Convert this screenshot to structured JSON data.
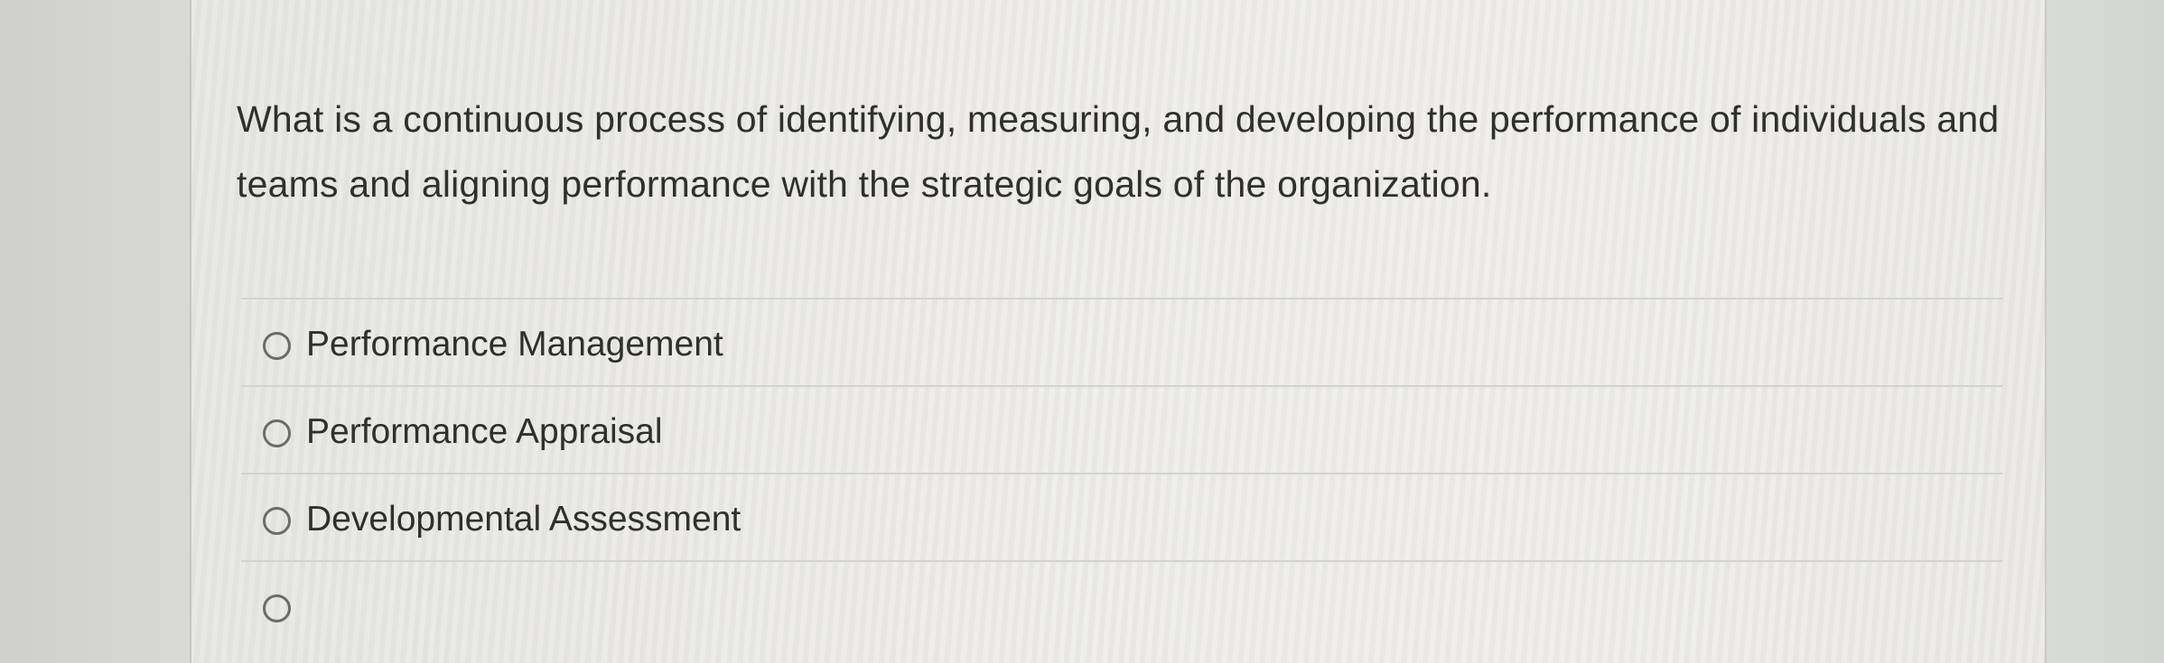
{
  "question": {
    "text": "What is a continuous process of identifying, measuring, and developing the performance of individuals and teams and aligning performance with the strategic goals of the organization."
  },
  "options": [
    {
      "label": "Performance Management",
      "selected": false
    },
    {
      "label": "Performance Appraisal",
      "selected": false
    },
    {
      "label": "Developmental Assessment",
      "selected": false
    },
    {
      "label": "",
      "selected": false
    }
  ]
}
